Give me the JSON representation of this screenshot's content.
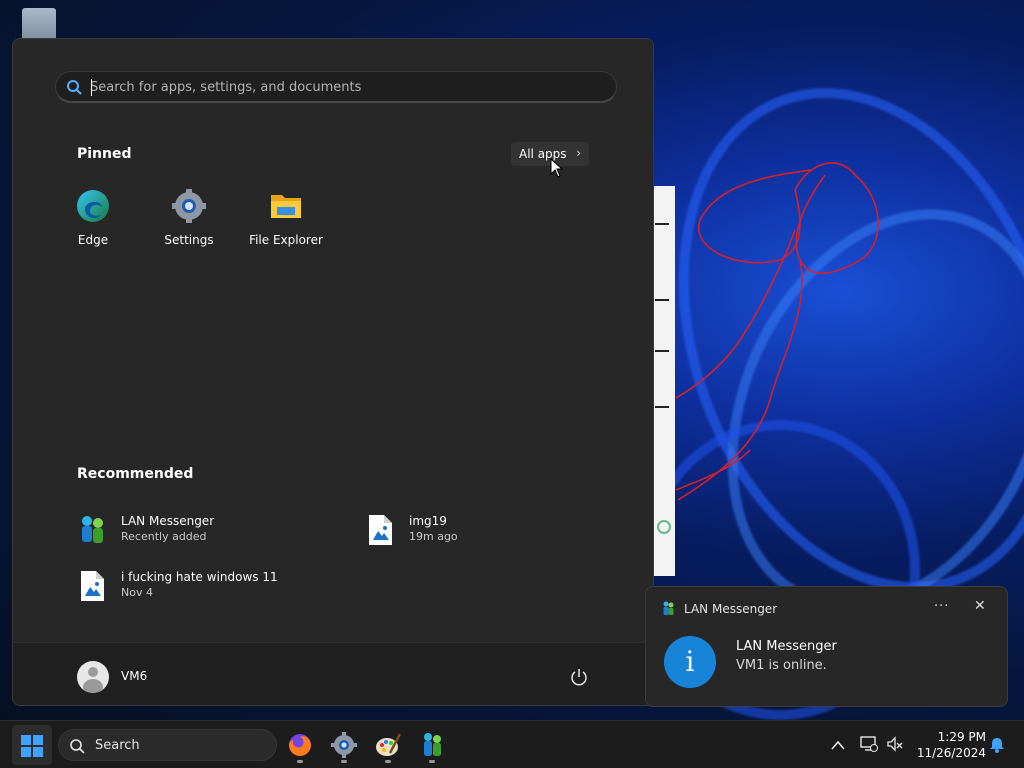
{
  "start_menu": {
    "search_placeholder": "Search for apps, settings, and documents",
    "pinned_title": "Pinned",
    "all_apps_label": "All apps",
    "pinned": [
      {
        "label": "Edge",
        "icon": "edge-icon"
      },
      {
        "label": "Settings",
        "icon": "settings-gear-icon"
      },
      {
        "label": "File Explorer",
        "icon": "folder-icon"
      }
    ],
    "recommended_title": "Recommended",
    "recommended": [
      {
        "title": "LAN Messenger",
        "subtitle": "Recently added",
        "icon": "lan-messenger-icon"
      },
      {
        "title": "img19",
        "subtitle": "19m ago",
        "icon": "image-file-icon"
      },
      {
        "title": "i fucking hate windows 11",
        "subtitle": "Nov 4",
        "icon": "image-file-icon"
      }
    ],
    "user_name": "VM6"
  },
  "notification": {
    "app_name": "LAN Messenger",
    "more_label": "···",
    "close_label": "✕",
    "info_glyph": "i",
    "title": "LAN Messenger",
    "body": "VM1 is online."
  },
  "taskbar": {
    "search_label": "Search",
    "apps": [
      "firefox-icon",
      "settings-icon",
      "paint-icon",
      "lan-messenger-icon"
    ],
    "time": "1:29 PM",
    "date": "11/26/2024"
  },
  "colors": {
    "accent": "#3ea3ff",
    "menu_bg": "#272727",
    "notification_info": "#1784d8",
    "drawing_stroke": "#d8202a"
  }
}
